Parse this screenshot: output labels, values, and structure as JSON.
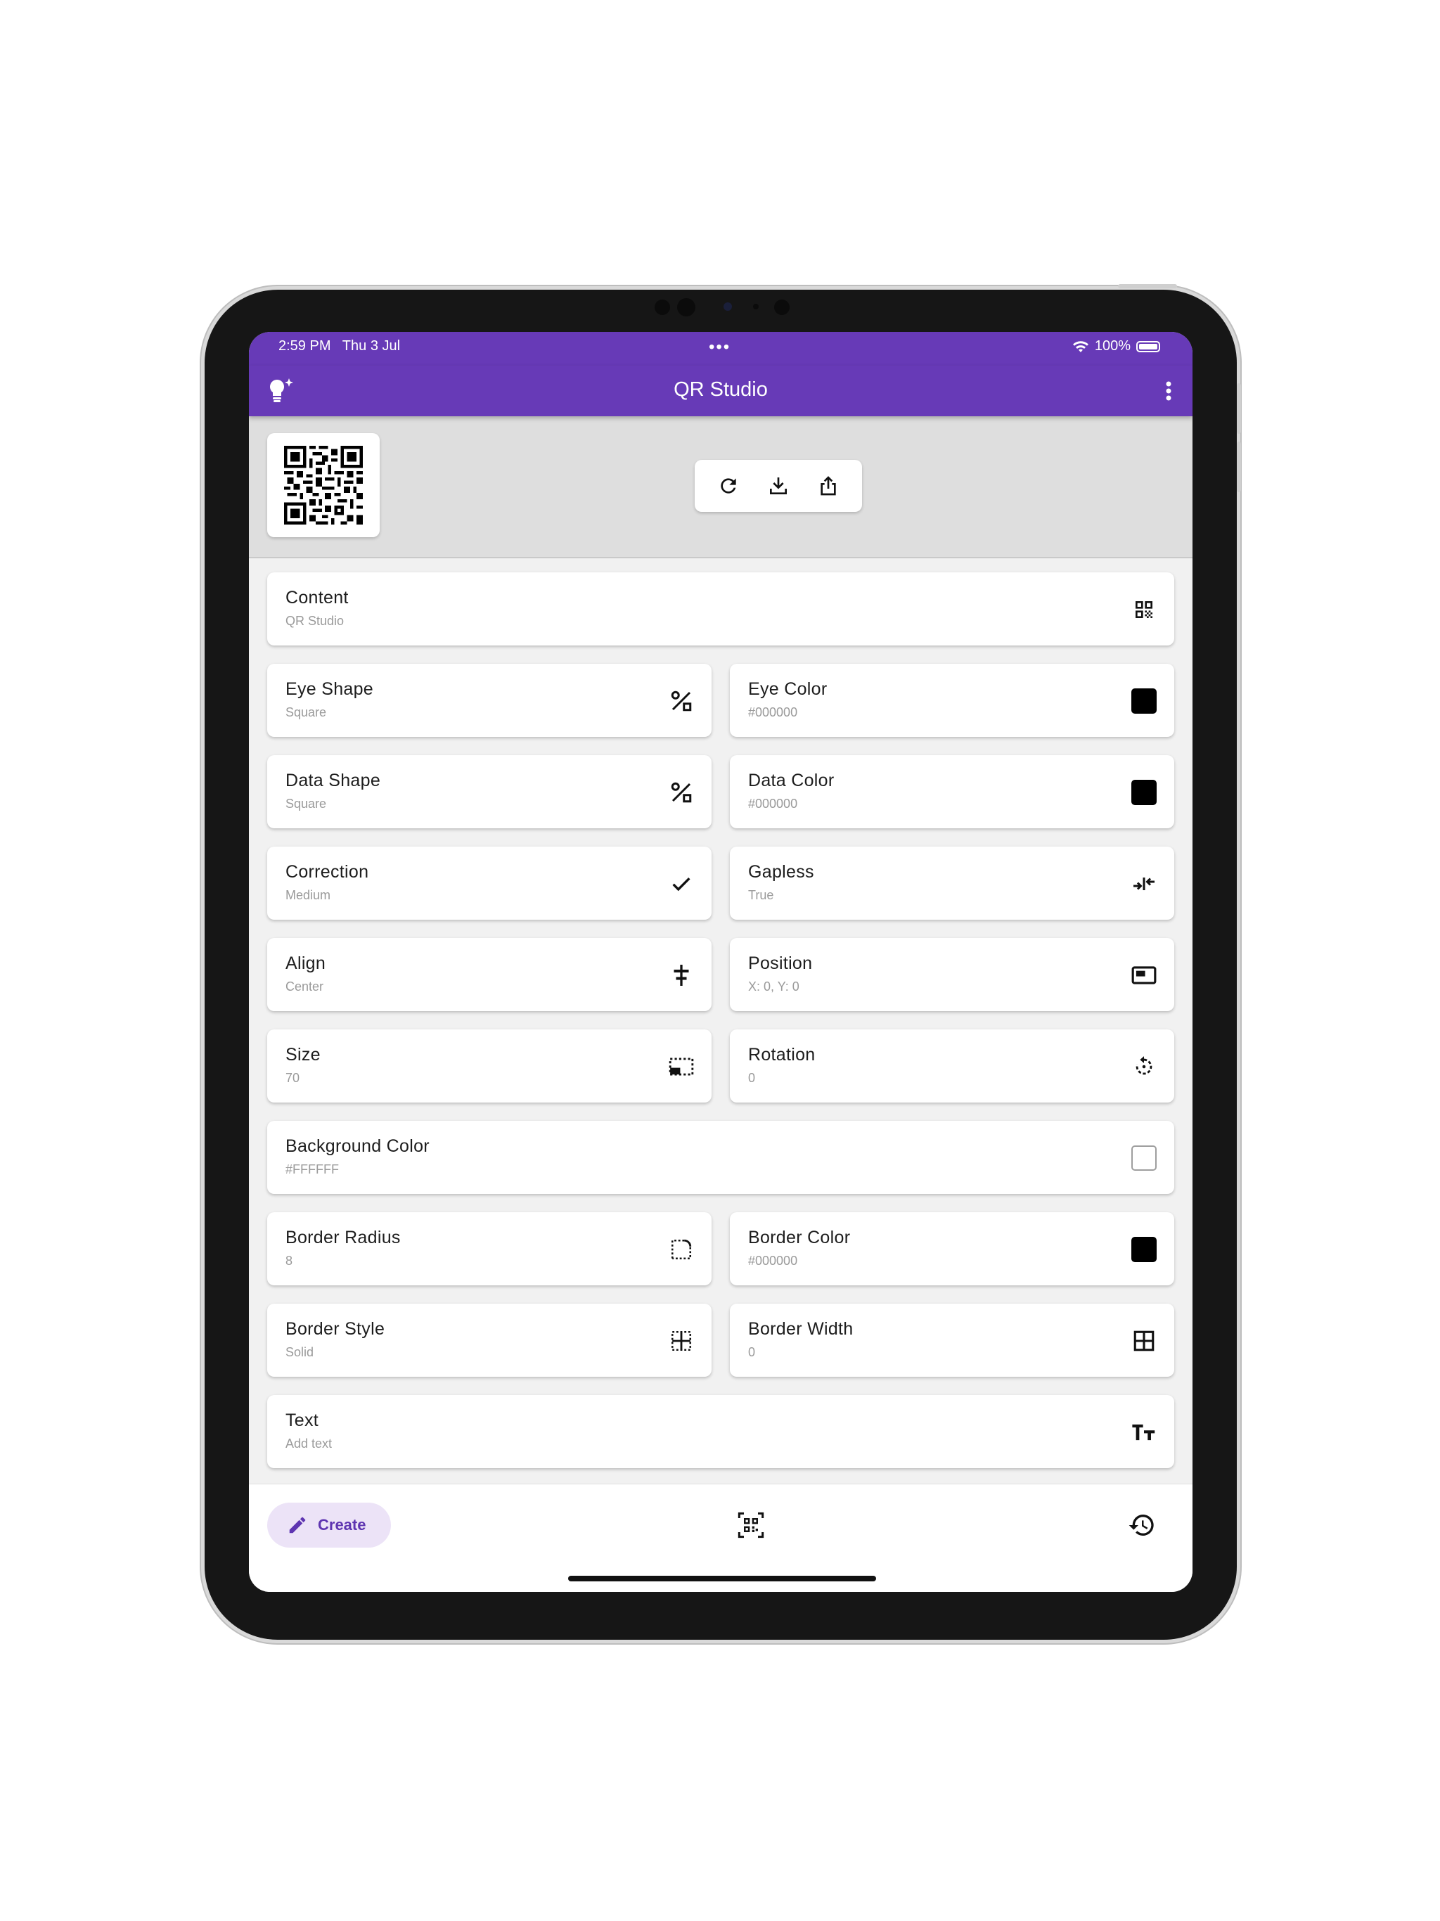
{
  "status_bar": {
    "time": "2:59 PM",
    "date": "Thu 3 Jul",
    "dots": "•••",
    "battery": "100%"
  },
  "app_bar": {
    "title": "QR Studio",
    "lead_icon": "lightbulb-sparkle-icon",
    "menu_icon": "more-vertical-icon"
  },
  "preview": {
    "actions": [
      "refresh-icon",
      "download-icon",
      "share-icon"
    ]
  },
  "settings": {
    "content": {
      "title": "Content",
      "value": "QR Studio",
      "icon": "qr-code-icon"
    },
    "eye_shape": {
      "title": "Eye Shape",
      "value": "Square",
      "icon": "shapes-icon"
    },
    "eye_color": {
      "title": "Eye Color",
      "value": "#000000",
      "swatch": "#000000"
    },
    "data_shape": {
      "title": "Data Shape",
      "value": "Square",
      "icon": "shapes-icon"
    },
    "data_color": {
      "title": "Data Color",
      "value": "#000000",
      "swatch": "#000000"
    },
    "correction": {
      "title": "Correction",
      "value": "Medium",
      "icon": "check-icon"
    },
    "gapless": {
      "title": "Gapless",
      "value": "True",
      "icon": "compress-arrows-icon"
    },
    "align": {
      "title": "Align",
      "value": "Center",
      "icon": "align-center-icon"
    },
    "position": {
      "title": "Position",
      "value": "X: 0, Y: 0",
      "icon": "picture-in-picture-icon"
    },
    "size": {
      "title": "Size",
      "value": "70",
      "icon": "resize-icon"
    },
    "rotation": {
      "title": "Rotation",
      "value": "0",
      "icon": "rotate-icon"
    },
    "background_color": {
      "title": "Background Color",
      "value": "#FFFFFF",
      "swatch": "#FFFFFF"
    },
    "border_radius": {
      "title": "Border Radius",
      "value": "8",
      "icon": "rounded-corner-icon"
    },
    "border_color": {
      "title": "Border Color",
      "value": "#000000",
      "swatch": "#000000"
    },
    "border_style": {
      "title": "Border Style",
      "value": "Solid",
      "icon": "border-inner-icon"
    },
    "border_width": {
      "title": "Border Width",
      "value": "0",
      "icon": "border-all-icon"
    },
    "text": {
      "title": "Text",
      "value": "Add text",
      "icon": "text-fields-icon"
    }
  },
  "bottom_nav": {
    "create_label": "Create",
    "items": [
      "edit-icon",
      "qr-scan-icon",
      "history-icon"
    ],
    "active": "Create"
  },
  "colors": {
    "primary": "#673ab7",
    "chip_bg": "#ece3f7",
    "chip_text": "#5e35b1"
  }
}
